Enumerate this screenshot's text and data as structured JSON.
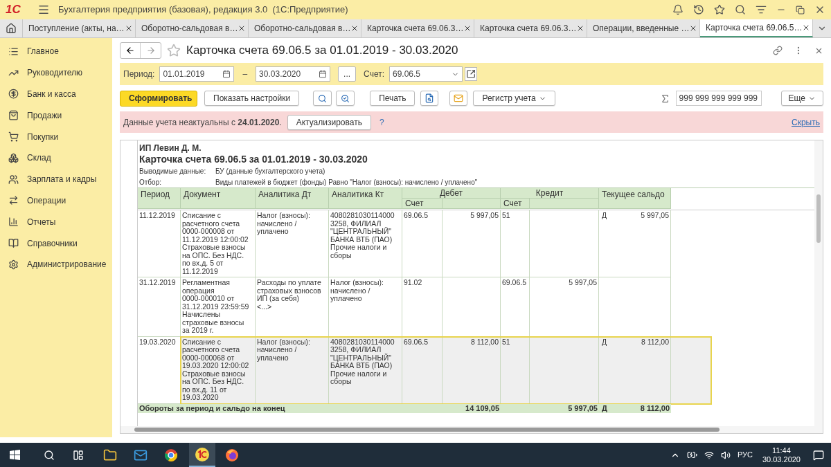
{
  "app": {
    "logo": "1С",
    "title": "Бухгалтерия предприятия (базовая), редакция 3.0  (1С:Предприятие)"
  },
  "tabs": [
    {
      "label": "Поступление (акты, на…",
      "selected": false
    },
    {
      "label": "Оборотно-сальдовая в…",
      "selected": false
    },
    {
      "label": "Оборотно-сальдовая в…",
      "selected": false
    },
    {
      "label": "Карточка счета 69.06.3…",
      "selected": false
    },
    {
      "label": "Карточка счета 69.06.3…",
      "selected": false
    },
    {
      "label": "Операции, введенные …",
      "selected": false
    },
    {
      "label": "Карточка счета 69.06.5…",
      "selected": true
    }
  ],
  "sidebar": [
    {
      "label": "Главное"
    },
    {
      "label": "Руководителю"
    },
    {
      "label": "Банк и касса"
    },
    {
      "label": "Продажи"
    },
    {
      "label": "Покупки"
    },
    {
      "label": "Склад"
    },
    {
      "label": "Зарплата и кадры"
    },
    {
      "label": "Операции"
    },
    {
      "label": "Отчеты"
    },
    {
      "label": "Справочники"
    },
    {
      "label": "Администрирование"
    }
  ],
  "form": {
    "title": "Карточка счета 69.06.5 за 01.01.2019 - 30.03.2020",
    "period_label": "Период:",
    "date_from": "01.01.2019",
    "dash": "–",
    "date_to": "30.03.2020",
    "ellipsis": "...",
    "account_label": "Счет:",
    "account": "69.06.5"
  },
  "toolbar": {
    "generate": "Сформировать",
    "settings": "Показать настройки",
    "print": "Печать",
    "register": "Регистр учета",
    "sum": "999 999 999 999 999",
    "more": "Еще"
  },
  "notice": {
    "text": "Данные учета неактуальны с **24.01.2020**.",
    "button": "Актуализировать",
    "help": "?",
    "hide": "Скрыть"
  },
  "report": {
    "org": "ИП Левин Д. М.",
    "title": "Карточка счета 69.06.5 за 01.01.2019 - 30.03.2020",
    "output_label": "Выводимые данные:",
    "output_value": "БУ (данные бухгалтерского учета)",
    "filter_label": "Отбор:",
    "filter_value": "Виды платежей в бюджет (фонды) Равно \"Налог (взносы): начислено / уплачено\"",
    "columns": {
      "period": "Период",
      "document": "Документ",
      "an_dt": "Аналитика Дт",
      "an_kt": "Аналитика Кт",
      "debit": "Дебет",
      "credit": "Кредит",
      "saldo": "Текущее сальдо",
      "debit_acc": "Счет",
      "credit_acc": "Счет"
    },
    "rows": [
      {
        "selected": false,
        "period": "11.12.2019",
        "document": "Списание с\nрасчетного счета\n0000-000008 от\n11.12.2019 12:00:02\nСтраховые взносы\nна ОПС. Без НДС.\nпо вх.д. 5 от\n11.12.2019",
        "an_dt": "Налог (взносы):\nначислено /\nуплачено",
        "an_kt": "4080281030114000\n3258, ФИЛИАЛ\n\"ЦЕНТРАЛЬНЫЙ\"\nБАНКА ВТБ (ПАО)\nПрочие налоги и\nсборы",
        "debit_acc": "69.06.5",
        "debit": "5 997,05",
        "credit_acc": "51",
        "credit": "",
        "saldo_side": "Д",
        "saldo": "5 997,05"
      },
      {
        "selected": false,
        "period": "31.12.2019",
        "document": "Регламентная\nоперация\n0000-000010 от\n31.12.2019 23:59:59\nНачислены\nстраховые взносы\nза 2019 г.",
        "an_dt": "Расходы по уплате\nстраховых взносов\nИП (за себя)\n<...>",
        "an_kt": "Налог (взносы):\nначислено /\nуплачено",
        "debit_acc": "91.02",
        "debit": "",
        "credit_acc": "69.06.5",
        "credit": "5 997,05",
        "saldo_side": "",
        "saldo": ""
      },
      {
        "selected": true,
        "period": "19.03.2020",
        "document": "Списание с\nрасчетного счета\n0000-000068 от\n19.03.2020 12:00:02\nСтраховые взносы\nна ОПС. Без НДС.\nпо вх.д. 11 от\n19.03.2020",
        "an_dt": "Налог (взносы):\nначислено /\nуплачено",
        "an_kt": "4080281030114000\n3258, ФИЛИАЛ\n\"ЦЕНТРАЛЬНЫЙ\"\nБАНКА ВТБ (ПАО)\nПрочие налоги и\nсборы",
        "debit_acc": "69.06.5",
        "debit": "8 112,00",
        "credit_acc": "51",
        "credit": "",
        "saldo_side": "Д",
        "saldo": "8 112,00"
      }
    ],
    "totals": {
      "label": "Обороты за период и сальдо на конец",
      "debit": "14 109,05",
      "credit": "5 997,05",
      "saldo_side": "Д",
      "saldo": "8 112,00"
    }
  },
  "taskbar": {
    "lang": "РУС",
    "time": "11:44",
    "date": "30.03.2020"
  }
}
